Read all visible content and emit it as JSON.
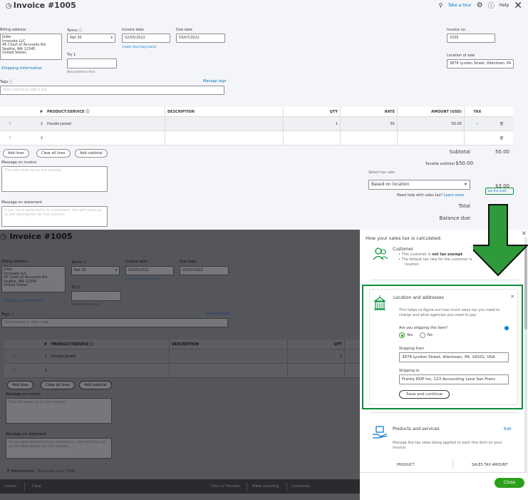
{
  "invoice": {
    "title": "Invoice #1005",
    "take_tour": "Take a tour",
    "help": "Help",
    "billing_address_label": "Billing address",
    "billing_address": [
      "Jinbe",
      "Innovate LLC",
      "45 Chart of Accounts Rd.",
      "Seattle, WA 12345",
      "United States"
    ],
    "terms_label": "Terms",
    "terms_value": "Net 30",
    "invoice_date_label": "Invoice date",
    "invoice_date": "02/05/2022",
    "due_date_label": "Due date",
    "due_date": "03/07/2022",
    "create_recurring": "Create recurring invoice",
    "try1_label": "Try 1",
    "not_printed": "Not printed on form",
    "shipping_info": "Shipping information",
    "tags_label": "Tags",
    "manage_tags": "Manage tags",
    "tags_placeholder": "Start typing to add a tag",
    "invoice_no_label": "Invoice no.",
    "invoice_no": "1005",
    "location_label": "Location of sale",
    "location_value": "3878 Lyndon Street, Allentown, PA",
    "columns": [
      "#",
      "PRODUCT/SERVICE",
      "DESCRIPTION",
      "QTY",
      "RATE",
      "AMOUNT (USD)",
      "TAX"
    ],
    "rows": [
      {
        "num": "1",
        "product": "Hoodie Jacket",
        "description": "",
        "qty": "1",
        "rate": "50",
        "amount": "50.00",
        "tax": "✓"
      },
      {
        "num": "2",
        "product": "",
        "description": "",
        "qty": "",
        "rate": "",
        "amount": "",
        "tax": ""
      }
    ],
    "add_lines": "Add lines",
    "clear_all_lines": "Clear all lines",
    "add_subtotal": "Add subtotal",
    "message_invoice_label": "Message on invoice",
    "message_invoice_placeholder": "This will show up on the invoice.",
    "message_statement_label": "Message on statement",
    "message_statement_placeholder": "If you send statements to customers, this will show up as the description for this invoice.",
    "subtotal_label": "Subtotal",
    "subtotal_value": "50.00",
    "taxable_subtotal_label": "Taxable subtotal",
    "taxable_subtotal_value": "$50.00",
    "select_tax_rate": "Select tax rate",
    "tax_rate_value": "Based on location",
    "need_help": "Need help with sales tax?",
    "learn_more": "Learn more",
    "tax_amount": "$3.00",
    "see_the_math": "See the math",
    "total_label": "Total",
    "balance_due_label": "Balance due"
  },
  "background": {
    "attachments": "Attachments",
    "max_size": "Maximum size: 20MB",
    "footer": {
      "cancel": "Cancel",
      "clear": "Clear",
      "print_preview": "Print or Preview",
      "make_recurring": "Make recurring",
      "customize": "Customize"
    }
  },
  "tax_panel": {
    "title": "How your sales tax is calculated:",
    "customer_heading": "Customer",
    "customer_bullet1_pre": "This customer is ",
    "customer_bullet1_bold": "not tax exempt",
    "customer_bullet2": "The default tax rate for the customer is",
    "customer_bullet2_cont": "location",
    "location_heading": "Location and addresses",
    "location_desc": "This helps us figure out how much sales tax you need to charge and what agencies you need to pay",
    "shipping_question": "Are you shipping this item?",
    "yes": "Yes",
    "no": "No",
    "shipping_from_label": "Shipping from",
    "shipping_from": "3878 Lyndon Street, Allentown, PA, 18101, USA",
    "shipping_to_label": "Shipping to",
    "shipping_to": "Franky RDP Inc, 123 Accounting Lane San Franc",
    "save_continue": "Save and continue",
    "products_heading": "Products and services",
    "edit": "Edit",
    "products_desc": "Manage the tax rates being applied to each line item on your invoice:",
    "col_product": "PRODUCT",
    "col_sales_tax": "SALES TAX AMOUNT",
    "close": "Close"
  },
  "colors": {
    "green": "#2ca01c",
    "highlight": "#0a8f3a",
    "link": "#0077c5"
  }
}
